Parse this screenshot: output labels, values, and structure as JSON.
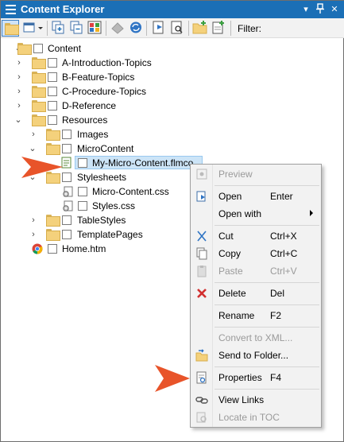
{
  "window": {
    "title": "Content Explorer",
    "pin_glyph": "p",
    "dropdown_glyph": "▾",
    "close_glyph": "✕"
  },
  "toolbar": {
    "filter_label": "Filter:"
  },
  "tree": {
    "items": [
      {
        "label": "Content"
      },
      {
        "label": "A-Introduction-Topics"
      },
      {
        "label": "B-Feature-Topics"
      },
      {
        "label": "C-Procedure-Topics"
      },
      {
        "label": "D-Reference"
      },
      {
        "label": "Resources"
      },
      {
        "label": "Images"
      },
      {
        "label": "MicroContent"
      },
      {
        "label": "My-Micro-Content.flmco"
      },
      {
        "label": "Stylesheets"
      },
      {
        "label": "Micro-Content.css"
      },
      {
        "label": "Styles.css"
      },
      {
        "label": "TableStyles"
      },
      {
        "label": "TemplatePages"
      },
      {
        "label": "Home.htm"
      }
    ]
  },
  "context_menu": {
    "items": [
      {
        "label": "Preview",
        "shortcut": "",
        "disabled": true
      },
      {
        "label": "Open",
        "shortcut": "Enter",
        "disabled": false
      },
      {
        "label": "Open with",
        "shortcut": "",
        "disabled": false
      },
      {
        "label": "Cut",
        "shortcut": "Ctrl+X",
        "disabled": false
      },
      {
        "label": "Copy",
        "shortcut": "Ctrl+C",
        "disabled": false
      },
      {
        "label": "Paste",
        "shortcut": "Ctrl+V",
        "disabled": true
      },
      {
        "label": "Delete",
        "shortcut": "Del",
        "disabled": false
      },
      {
        "label": "Rename",
        "shortcut": "F2",
        "disabled": false
      },
      {
        "label": "Convert to XML...",
        "shortcut": "",
        "disabled": true
      },
      {
        "label": "Send to Folder...",
        "shortcut": "",
        "disabled": false
      },
      {
        "label": "Properties",
        "shortcut": "F4",
        "disabled": false
      },
      {
        "label": "View Links",
        "shortcut": "",
        "disabled": false
      },
      {
        "label": "Locate in TOC",
        "shortcut": "",
        "disabled": true
      }
    ]
  },
  "colors": {
    "titlebar": "#1b6fb6",
    "callout_arrow": "#e8542a",
    "selection": "#cce4f7"
  }
}
